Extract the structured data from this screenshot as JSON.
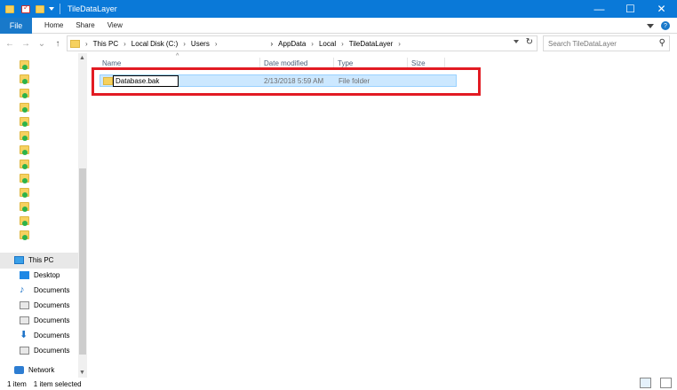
{
  "window": {
    "title": "TileDataLayer",
    "minimize": "—",
    "maximize": "☐",
    "close": "✕"
  },
  "ribbon": {
    "file": "File",
    "tabs": [
      "Home",
      "Share",
      "View"
    ]
  },
  "nav": {
    "back": "←",
    "forward": "→",
    "recent": "⌄",
    "up": "↑"
  },
  "address": {
    "crumbs": [
      "This PC",
      "Local Disk (C:)",
      "Users",
      "AppData",
      "Local",
      "TileDataLayer"
    ]
  },
  "search": {
    "placeholder": "Search TileDataLayer"
  },
  "navpane": {
    "this_pc": "This PC",
    "items": [
      "Desktop",
      "Documents",
      "Documents",
      "Documents",
      "Documents",
      "Documents"
    ],
    "network": "Network"
  },
  "columns": {
    "name": "Name",
    "date": "Date modified",
    "type": "Type",
    "size": "Size"
  },
  "rows": [
    {
      "name": "Database.bak",
      "date": "2/13/2018 5:59 AM",
      "type": "File folder",
      "size": ""
    }
  ],
  "status": {
    "count": "1 item",
    "selected": "1 item selected"
  },
  "colors": {
    "titlebar": "#0a79d8",
    "selection": "#cce8ff",
    "highlight": "#e21b23"
  }
}
